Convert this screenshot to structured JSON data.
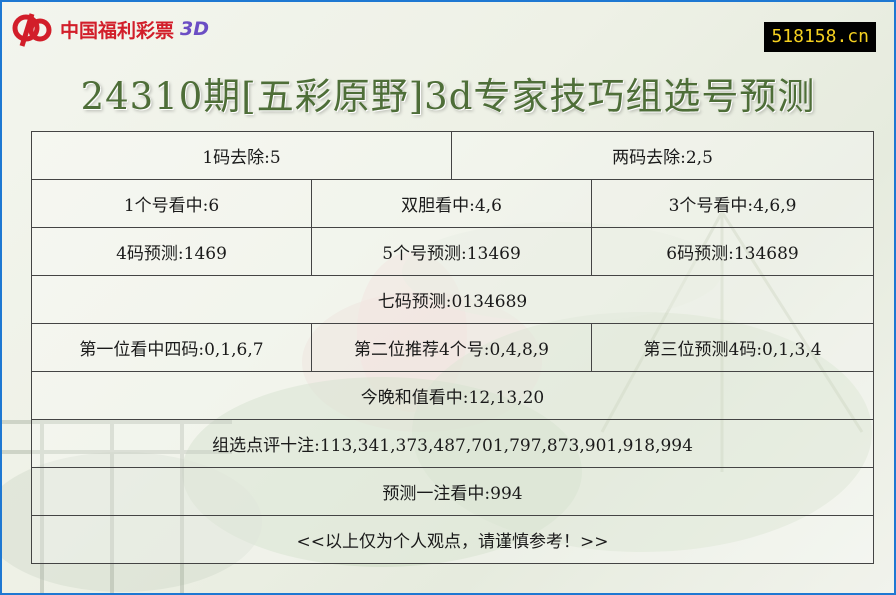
{
  "logo": {
    "text": "中国福利彩票",
    "suffix": "3D"
  },
  "site_badge": "518158.cn",
  "title": "24310期[五彩原野]3d专家技巧组选号预测",
  "rows": {
    "r1": [
      "1码去除:5",
      "两码去除:2,5"
    ],
    "r2": [
      "1个号看中:6",
      "双胆看中:4,6",
      "3个号看中:4,6,9"
    ],
    "r3": [
      "4码预测:1469",
      "5个号预测:13469",
      "6码预测:134689"
    ],
    "r4": "七码预测:0134689",
    "r5": [
      "第一位看中四码:0,1,6,7",
      "第二位推荐4个号:0,4,8,9",
      "第三位预测4码:0,1,3,4"
    ],
    "r6": "今晚和值看中:12,13,20",
    "r7": "组选点评十注:113,341,373,487,701,797,873,901,918,994",
    "r8": "预测一注看中:994",
    "r9": "<<以上仅为个人观点，请谨慎参考！>>"
  },
  "colors": {
    "border": "#1e78d2",
    "title": "#4e6e38",
    "logo_red": "#d21e2a",
    "logo_3d": "#6b4ec4",
    "badge_bg": "#000000",
    "badge_text": "#f4d020"
  }
}
